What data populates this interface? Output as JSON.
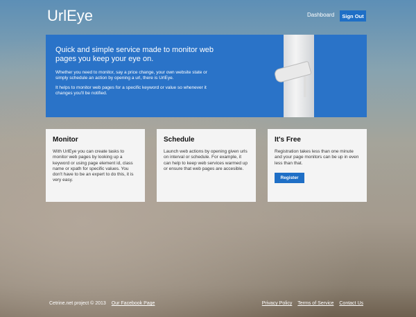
{
  "header": {
    "logo": "UrlEye",
    "dashboard": "Dashboard",
    "sign_out": "Sign Out"
  },
  "banner": {
    "headline": "Quick and simple service made to monitor web pages you keep your eye on.",
    "p1": "Whether you need to monitor, say a price change, your own website state or simply schedule an action by opening a url, there is UrlEye.",
    "p2": "It helps to monitor web pages for a specific keyword or value so whenever it changes you'll be notified."
  },
  "cards": [
    {
      "title": "Monitor",
      "text": "With UrlEye you can create tasks to monitor web pages by looking up a keyword or using page element id, class name or xpath for specific values. You don't have to be an expert to do this, it is very easy."
    },
    {
      "title": "Schedule",
      "text": "Launch web actions by opening given urls on interval or schedule. For example, it can help to keep web services warmed up or ensure that web pages are accesible."
    },
    {
      "title": "It's Free",
      "text": "Registration takes less than one minute and your page monitors can be up in even less than that.",
      "button": "Register"
    }
  ],
  "footer": {
    "copyright": "Cetrine.net project © 2013",
    "facebook": "Our Facebook Page",
    "privacy": "Privacy Policy",
    "terms": "Terms of Service",
    "contact": "Contact Us"
  }
}
